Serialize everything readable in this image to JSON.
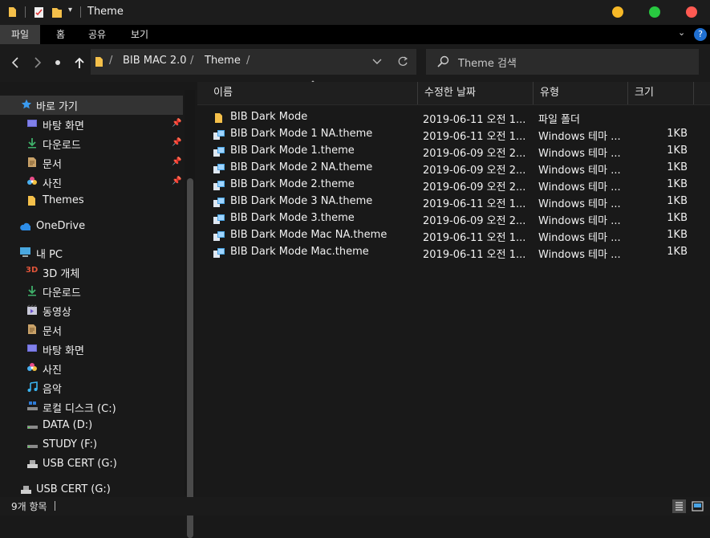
{
  "titlebar": {
    "title": "Theme",
    "accent_colors": {
      "minimize": "#f6b827",
      "maximize": "#28c840",
      "close": "#ff5a52"
    }
  },
  "ribbon": {
    "tabs": [
      "파일",
      "홈",
      "공유",
      "보기"
    ],
    "help": "?"
  },
  "address": {
    "crumbs": [
      "BIB MAC 2.0",
      "Theme"
    ],
    "separator": "/",
    "search_placeholder": "Theme 검색"
  },
  "nav": {
    "quick_access": {
      "label": "바로 가기"
    },
    "quick_items": [
      {
        "label": "바탕 화면",
        "icon": "desktop-icon",
        "pinned": true
      },
      {
        "label": "다운로드",
        "icon": "download-icon",
        "pinned": true
      },
      {
        "label": "문서",
        "icon": "document-icon",
        "pinned": true
      },
      {
        "label": "사진",
        "icon": "photos-icon",
        "pinned": true
      },
      {
        "label": "Themes",
        "icon": "folder-icon",
        "pinned": false
      }
    ],
    "onedrive": {
      "label": "OneDrive"
    },
    "this_pc": {
      "label": "내 PC"
    },
    "pc_items": [
      {
        "label": "3D 개체",
        "icon": "3d-objects-icon"
      },
      {
        "label": "다운로드",
        "icon": "download-icon"
      },
      {
        "label": "동영상",
        "icon": "video-icon"
      },
      {
        "label": "문서",
        "icon": "document-icon"
      },
      {
        "label": "바탕 화면",
        "icon": "desktop-icon"
      },
      {
        "label": "사진",
        "icon": "photos-icon"
      },
      {
        "label": "음악",
        "icon": "music-icon"
      },
      {
        "label": "로컬 디스크 (C:)",
        "icon": "drive-c-icon"
      },
      {
        "label": "DATA (D:)",
        "icon": "drive-icon"
      },
      {
        "label": "STUDY (F:)",
        "icon": "drive-icon"
      },
      {
        "label": "USB CERT (G:)",
        "icon": "usb-drive-icon"
      }
    ],
    "usb_root": {
      "label": "USB CERT (G:)"
    }
  },
  "columns": {
    "name": "이름",
    "date": "수정한 날짜",
    "type": "유형",
    "size": "크기"
  },
  "files": [
    {
      "name": "BIB Dark Mode",
      "date": "2019-06-11 오전 1...",
      "type": "파일 폴더",
      "size": "",
      "icon": "folder-icon"
    },
    {
      "name": "BIB Dark Mode 1 NA.theme",
      "date": "2019-06-11 오전 1...",
      "type": "Windows 테마 ...",
      "size": "1KB",
      "icon": "theme-file-icon"
    },
    {
      "name": "BIB Dark Mode 1.theme",
      "date": "2019-06-09 오전 2...",
      "type": "Windows 테마 ...",
      "size": "1KB",
      "icon": "theme-file-icon"
    },
    {
      "name": "BIB Dark Mode 2 NA.theme",
      "date": "2019-06-09 오전 2...",
      "type": "Windows 테마 ...",
      "size": "1KB",
      "icon": "theme-file-icon"
    },
    {
      "name": "BIB Dark Mode 2.theme",
      "date": "2019-06-09 오전 2...",
      "type": "Windows 테마 ...",
      "size": "1KB",
      "icon": "theme-file-icon"
    },
    {
      "name": "BIB Dark Mode 3 NA.theme",
      "date": "2019-06-11 오전 1...",
      "type": "Windows 테마 ...",
      "size": "1KB",
      "icon": "theme-file-icon"
    },
    {
      "name": "BIB Dark Mode 3.theme",
      "date": "2019-06-09 오전 2...",
      "type": "Windows 테마 ...",
      "size": "1KB",
      "icon": "theme-file-icon"
    },
    {
      "name": "BIB Dark Mode Mac NA.theme",
      "date": "2019-06-11 오전 1...",
      "type": "Windows 테마 ...",
      "size": "1KB",
      "icon": "theme-file-icon"
    },
    {
      "name": "BIB Dark Mode Mac.theme",
      "date": "2019-06-11 오전 1...",
      "type": "Windows 테마 ...",
      "size": "1KB",
      "icon": "theme-file-icon"
    }
  ],
  "status": {
    "count": "9개 항목"
  }
}
